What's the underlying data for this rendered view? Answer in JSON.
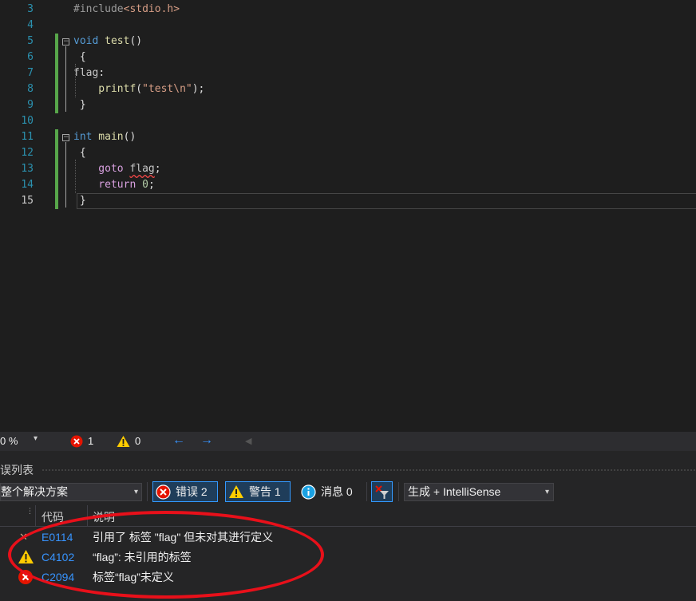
{
  "editor": {
    "lines": [
      {
        "num": "3",
        "parts": [
          {
            "t": "#include",
            "c": "inc"
          },
          {
            "t": "<stdio.h>",
            "c": "str"
          }
        ]
      },
      {
        "num": "4",
        "parts": []
      },
      {
        "num": "5",
        "parts": [
          {
            "t": "void",
            "c": "kw"
          },
          {
            "t": " test",
            "c": "fn"
          },
          {
            "t": "()",
            "c": ""
          }
        ]
      },
      {
        "num": "6",
        "parts": [
          {
            "t": " {",
            "c": ""
          }
        ]
      },
      {
        "num": "7",
        "parts": [
          {
            "t": "flag",
            "c": "lbl"
          },
          {
            "t": ":",
            "c": ""
          }
        ]
      },
      {
        "num": "8",
        "parts": [
          {
            "t": "    printf",
            "c": "fn"
          },
          {
            "t": "(",
            "c": ""
          },
          {
            "t": "\"test\\n\"",
            "c": "str"
          },
          {
            "t": ");",
            "c": ""
          }
        ]
      },
      {
        "num": "9",
        "parts": [
          {
            "t": " }",
            "c": ""
          }
        ]
      },
      {
        "num": "10",
        "parts": []
      },
      {
        "num": "11",
        "parts": [
          {
            "t": "int",
            "c": "kw"
          },
          {
            "t": " main",
            "c": "fn"
          },
          {
            "t": "()",
            "c": ""
          }
        ]
      },
      {
        "num": "12",
        "parts": [
          {
            "t": " {",
            "c": ""
          }
        ]
      },
      {
        "num": "13",
        "parts": [
          {
            "t": "    goto",
            "c": "ctl"
          },
          {
            "t": " ",
            "c": ""
          },
          {
            "t": "flag",
            "c": "lbl squig"
          },
          {
            "t": ";",
            "c": ""
          }
        ]
      },
      {
        "num": "14",
        "parts": [
          {
            "t": "    return",
            "c": "ctl"
          },
          {
            "t": " ",
            "c": ""
          },
          {
            "t": "0",
            "c": "num"
          },
          {
            "t": ";",
            "c": ""
          }
        ]
      },
      {
        "num": "15",
        "parts": [
          {
            "t": " }",
            "c": ""
          }
        ]
      }
    ]
  },
  "status": {
    "zoom": "0 %",
    "errors": "1",
    "warnings": "0"
  },
  "panel": {
    "title": "误列表",
    "scope": "整个解决方案",
    "errors_label": "错误 2",
    "warnings_label": "警告 1",
    "messages_label": "消息 0",
    "source": "生成 + IntelliSense",
    "col_code": "代码",
    "col_desc": "说明",
    "rows": [
      {
        "type": "error-partial",
        "code": "E0114",
        "desc": "引用了 标签 \"flag\" 但未对其进行定义"
      },
      {
        "type": "warning",
        "code": "C4102",
        "desc": "“flag”: 未引用的标签"
      },
      {
        "type": "error",
        "code": "C2094",
        "desc": "标签“flag”未定义"
      }
    ]
  },
  "colors": {
    "accent": "#3399ff",
    "error": "#e51400",
    "warning": "#ffcc00",
    "info": "#1ba1e2",
    "annotation": "#e8101a"
  }
}
